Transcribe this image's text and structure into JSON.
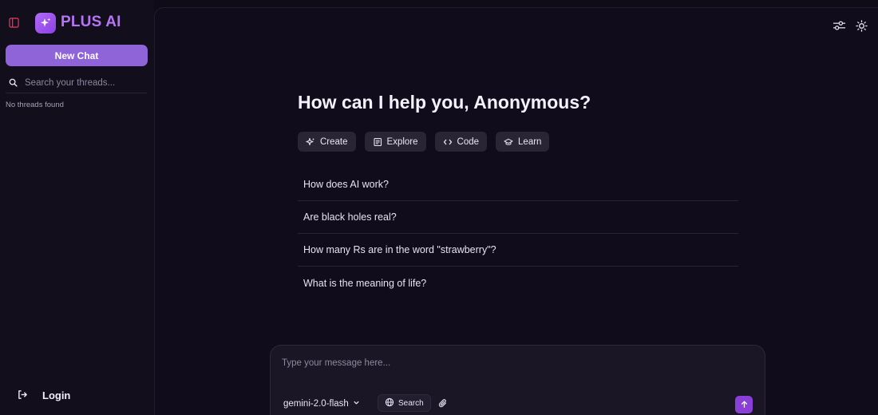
{
  "colors": {
    "accent": "#8e64d8",
    "brand": "#b775f5",
    "send": "#8a3fd9",
    "background": "#0f0b18"
  },
  "sidebar": {
    "toggle_icon": "sidebar-toggle-icon",
    "logo_icon": "sparkles-icon",
    "logo_text": "PLUS AI",
    "new_chat_label": "New Chat",
    "search": {
      "icon": "search-icon",
      "placeholder": "Search your threads..."
    },
    "empty_state": "No threads found",
    "login": {
      "icon": "login-icon",
      "label": "Login"
    }
  },
  "header": {
    "icons": [
      "sliders-icon",
      "sun-icon"
    ]
  },
  "main": {
    "greeting": "How can I help you, Anonymous?",
    "actions": [
      {
        "label": "Create",
        "icon": "sparkles-icon"
      },
      {
        "label": "Explore",
        "icon": "newspaper-icon"
      },
      {
        "label": "Code",
        "icon": "code-icon"
      },
      {
        "label": "Learn",
        "icon": "graduation-cap-icon"
      }
    ],
    "suggestions": [
      "How does AI work?",
      "Are black holes real?",
      "How many Rs are in the word \"strawberry\"?",
      "What is the meaning of life?"
    ]
  },
  "composer": {
    "placeholder": "Type your message here...",
    "model": "gemini-2.0-flash",
    "search_label": "Search",
    "attach_icon": "paperclip-icon",
    "send_icon": "arrow-up-icon"
  }
}
